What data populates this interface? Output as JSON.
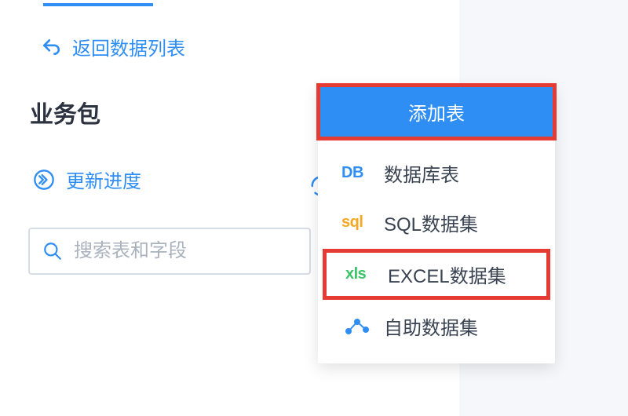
{
  "nav": {
    "back_label": "返回数据列表"
  },
  "section": {
    "title": "业务包"
  },
  "progress": {
    "label": "更新进度"
  },
  "search": {
    "placeholder": "搜索表和字段"
  },
  "dropdown": {
    "header": "添加表",
    "items": [
      {
        "icon": "DB",
        "label": "数据库表",
        "icon_color": "db"
      },
      {
        "icon": "sql",
        "label": "SQL数据集",
        "icon_color": "sql"
      },
      {
        "icon": "xls",
        "label": "EXCEL数据集",
        "icon_color": "xls"
      },
      {
        "icon": "self",
        "label": "自助数据集",
        "icon_color": "self"
      }
    ]
  },
  "highlights": {
    "header": true,
    "excel_item": true
  },
  "colors": {
    "primary": "#2f8ef4",
    "highlight": "#e63b33",
    "sql": "#f5a623",
    "xls": "#3cc268"
  }
}
